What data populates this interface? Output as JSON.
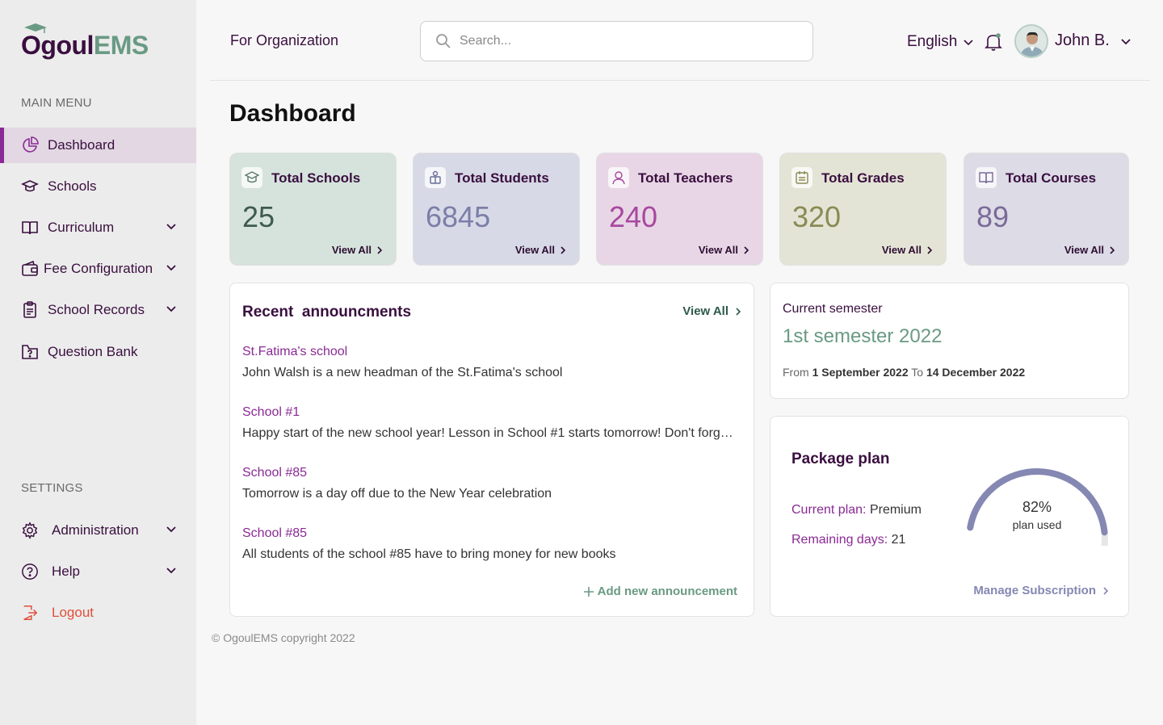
{
  "brand": {
    "logo_part1": "Ogoul",
    "logo_part2": "EMS"
  },
  "sidebar": {
    "main_menu_heading": "MAIN MENU",
    "items": [
      {
        "label": "Dashboard",
        "icon": "chart-pie-icon",
        "active": true
      },
      {
        "label": "Schools",
        "icon": "graduation-cap-icon"
      },
      {
        "label": "Curriculum",
        "icon": "book-open-icon"
      },
      {
        "label": "Fee Configuration",
        "icon": "wallet-icon"
      },
      {
        "label": "School Records",
        "icon": "clipboard-icon"
      },
      {
        "label": "Question Bank",
        "icon": "question-folder-icon"
      }
    ],
    "settings_heading": "SETTINGS",
    "settings_items": [
      {
        "label": "Administration",
        "icon": "gear-icon"
      },
      {
        "label": "Help",
        "icon": "help-circle-icon"
      },
      {
        "label": "Logout",
        "icon": "logout-icon"
      }
    ]
  },
  "header": {
    "org_label": "For Organization",
    "search_placeholder": "Search...",
    "language": "English",
    "user_name": "John B."
  },
  "page_title": "Dashboard",
  "stats": [
    {
      "title": "Total Schools",
      "value": "25",
      "view": "View All",
      "icon": "school-hat-icon",
      "bg": "#d5e3dc",
      "value_color": "#3f5a50"
    },
    {
      "title": "Total Students",
      "value": "6845",
      "view": "View All",
      "icon": "student-icon",
      "bg": "#d7d9e6",
      "value_color": "#7a7ea8"
    },
    {
      "title": "Total Teachers",
      "value": "240",
      "view": "View All",
      "icon": "teacher-icon",
      "bg": "#e8d6e6",
      "value_color": "#a8489f"
    },
    {
      "title": "Total Grades",
      "value": "320",
      "view": "View All",
      "icon": "calendar-icon",
      "bg": "#e4e4d6",
      "value_color": "#8a8a55"
    },
    {
      "title": "Total Courses",
      "value": "89",
      "view": "View All",
      "icon": "open-book-icon",
      "bg": "#dcdbe6",
      "value_color": "#7a6a98"
    }
  ],
  "announcements": {
    "title": "Recent  announcments",
    "view_all": "View All",
    "items": [
      {
        "school": "St.Fatima's school",
        "text": "John Walsh is a new headman of the St.Fatima's school"
      },
      {
        "school": "School #1",
        "text": "Happy start of the new school year! Lesson in School #1 starts tomorrow! Don't forget to bring your textbooks"
      },
      {
        "school": "School #85",
        "text": "Tomorrow is a day off due to the New Year celebration"
      },
      {
        "school": "School #85",
        "text": "All students of the school #85 have to bring money for new books"
      }
    ],
    "add_label": "Add new announcement"
  },
  "semester": {
    "label": "Current semester",
    "name": "1st semester 2022",
    "from_label": "From",
    "from_date": "1 September 2022",
    "to_label": "To",
    "to_date": "14 December 2022"
  },
  "package": {
    "title": "Package plan",
    "plan_key": "Current plan:",
    "plan_value": "Premium",
    "days_key": "Remaining days:",
    "days_value": "21",
    "percent_used": 82,
    "percent_label": "82%",
    "used_label": "plan used",
    "manage_label": "Manage Subscription",
    "gauge_color": "#8488b2"
  },
  "footer": {
    "copyright": "© OgoulEMS copyright 2022"
  }
}
